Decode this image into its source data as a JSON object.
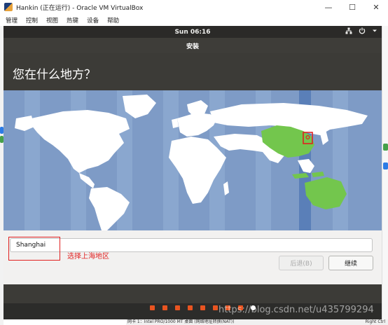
{
  "vbox": {
    "window_title": "Hankin (正在运行) - Oracle VM VirtualBox",
    "menus": [
      "管理",
      "控制",
      "视图",
      "热键",
      "设备",
      "帮助"
    ],
    "status_text": "网卡 1：Intel PRO/1000 MT 桌面 (网络地址转换(NAT))",
    "host_key": "Right Ctrl"
  },
  "gnome": {
    "clock": "Sun 06:16"
  },
  "installer": {
    "title": "安装",
    "question": "您在什么地方？",
    "location_value": "Shanghai",
    "annotation": "选择上海地区",
    "back_label": "后退(B)",
    "continue_label": "继续",
    "progress": {
      "done_steps": 8,
      "current_step": 9,
      "total_steps": 9
    }
  },
  "watermark": "https://blog.csdn.net/u435799294",
  "colors": {
    "ubuntu_orange": "#e95420",
    "annotation_red": "#e02020",
    "map_ocean": "#7e9bc6",
    "land": "#ffffff",
    "selected_land": "#73c64d"
  },
  "icons": [
    "network-icon",
    "power-icon",
    "chevron-down-icon",
    "minimize-icon",
    "maximize-icon",
    "close-icon"
  ]
}
